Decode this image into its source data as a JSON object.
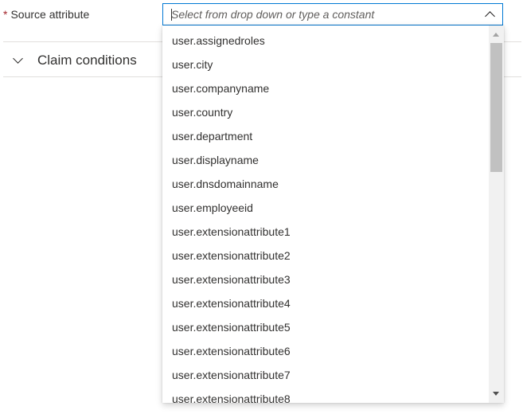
{
  "source_attribute": {
    "required_marker": "*",
    "label": "Source attribute",
    "input": {
      "value": "",
      "placeholder": "Select from drop down or type a constant"
    },
    "expanded": true,
    "options": [
      "user.assignedroles",
      "user.city",
      "user.companyname",
      "user.country",
      "user.department",
      "user.displayname",
      "user.dnsdomainname",
      "user.employeeid",
      "user.extensionattribute1",
      "user.extensionattribute2",
      "user.extensionattribute3",
      "user.extensionattribute4",
      "user.extensionattribute5",
      "user.extensionattribute6",
      "user.extensionattribute7",
      "user.extensionattribute8"
    ]
  },
  "claim_conditions": {
    "label": "Claim conditions",
    "expanded": false
  },
  "colors": {
    "accent": "#0078d4",
    "required": "#a4262c",
    "text": "#323130",
    "divider": "#e1dfdd"
  }
}
